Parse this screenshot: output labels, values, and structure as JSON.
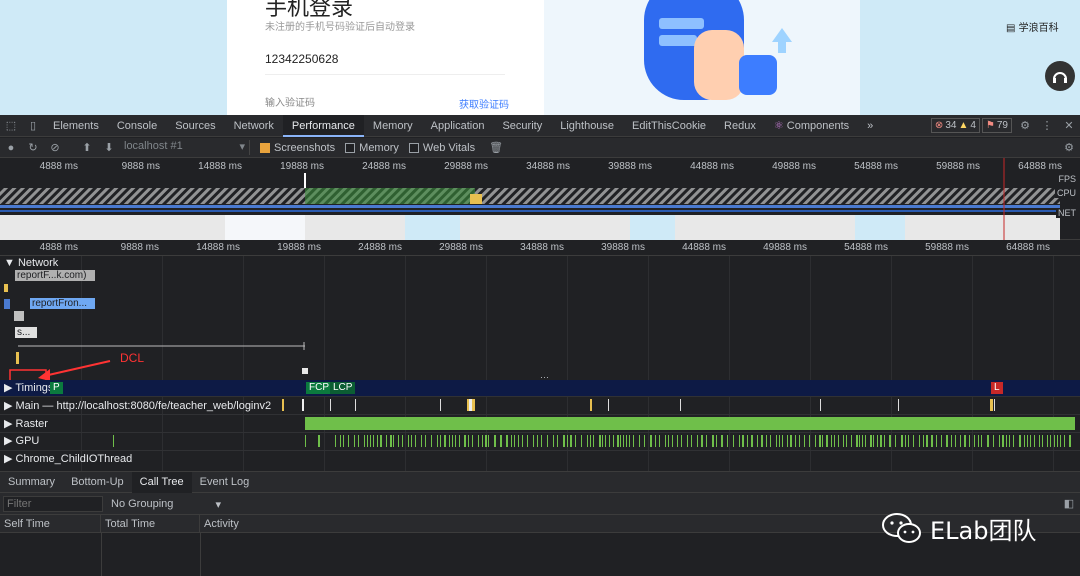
{
  "page": {
    "login_title": "手机登录",
    "login_subtitle": "未注册的手机号码验证后自动登录",
    "phone_value": "12342250628",
    "code_placeholder": "输入验证码",
    "get_code_link": "获取验证码",
    "side_link": "学浪百科"
  },
  "devtools": {
    "tabs": [
      "Elements",
      "Console",
      "Sources",
      "Network",
      "Performance",
      "Memory",
      "Application",
      "Security",
      "Lighthouse",
      "EditThisCookie",
      "Redux",
      "Components"
    ],
    "active_tab": "Performance",
    "more": "»",
    "errors": "34",
    "warnings": "4",
    "issues": "79",
    "toolbar": {
      "target": "localhost #1",
      "screenshots_label": "Screenshots",
      "screenshots_checked": true,
      "memory_label": "Memory",
      "web_vitals_label": "Web Vitals"
    },
    "overview_labels": [
      "FPS",
      "CPU",
      "NET"
    ],
    "time_ticks": [
      "4888 ms",
      "9888 ms",
      "14888 ms",
      "19888 ms",
      "24888 ms",
      "29888 ms",
      "34888 ms",
      "39888 ms",
      "44888 ms",
      "49888 ms",
      "54888 ms",
      "59888 ms",
      "64888 ms"
    ],
    "network_header": "Network",
    "network_items": [
      "reportF...k.com)",
      "reportFron...",
      "s..."
    ],
    "annotation": "DCL",
    "tracks": {
      "timings": "Timings",
      "main": "Main — http://localhost:8080/fe/teacher_web/loginv2",
      "raster": "Raster",
      "gpu": "GPU",
      "child_io": "Chrome_ChildIOThread"
    },
    "markers": {
      "fcp": "FCP",
      "lcp": "LCP",
      "l": "L",
      "p": "P"
    },
    "bottom_tabs": [
      "Summary",
      "Bottom-Up",
      "Call Tree",
      "Event Log"
    ],
    "active_bottom_tab": "Call Tree",
    "filter_placeholder": "Filter",
    "grouping": "No Grouping",
    "columns": [
      "Self Time",
      "Total Time",
      "Activity"
    ]
  },
  "watermark": "ELab团队",
  "colors": {
    "accent_blue": "#8ab4f8",
    "fcp": "#0b7a3e",
    "lcp": "#0b5d33",
    "load": "#c62828",
    "raster": "#6fbf4a",
    "timings_bg": "#0d1a45"
  }
}
